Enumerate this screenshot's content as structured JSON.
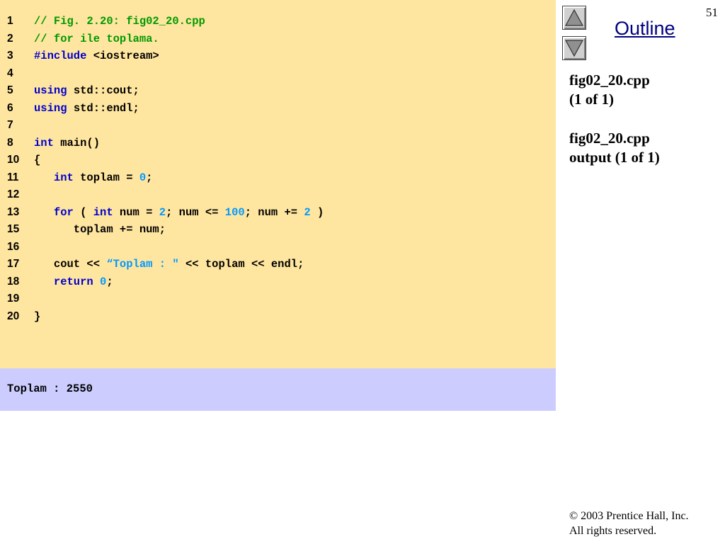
{
  "slide_number": "51",
  "outline": {
    "label": "Outline"
  },
  "nav": {
    "up_icon": "triangle-up-icon",
    "down_icon": "triangle-down-icon"
  },
  "sidebar": {
    "lines": [
      "fig02_20.cpp",
      "(1 of 1)",
      "fig02_20.cpp",
      "output (1 of 1)"
    ]
  },
  "code_lines": [
    {
      "num": "1",
      "tokens": [
        {
          "t": "// Fig. 2.20: fig02_20.cpp",
          "c": "comment"
        }
      ]
    },
    {
      "num": "2",
      "tokens": [
        {
          "t": "// for ile toplama.",
          "c": "comment"
        }
      ]
    },
    {
      "num": "3",
      "tokens": [
        {
          "t": "#include",
          "c": "keyword"
        },
        {
          "t": " <iostream>",
          "c": "plain"
        }
      ]
    },
    {
      "num": "4",
      "tokens": []
    },
    {
      "num": "5",
      "tokens": [
        {
          "t": "using",
          "c": "keyword"
        },
        {
          "t": " std::cout;",
          "c": "plain"
        }
      ]
    },
    {
      "num": "6",
      "tokens": [
        {
          "t": "using",
          "c": "keyword"
        },
        {
          "t": " std::endl;",
          "c": "plain"
        }
      ]
    },
    {
      "num": "7",
      "tokens": []
    },
    {
      "num": "8",
      "tokens": [
        {
          "t": "int",
          "c": "keyword"
        },
        {
          "t": " main()",
          "c": "plain"
        }
      ]
    },
    {
      "num": "10",
      "tokens": [
        {
          "t": "{",
          "c": "plain"
        }
      ]
    },
    {
      "num": "11",
      "tokens": [
        {
          "t": "   ",
          "c": "plain"
        },
        {
          "t": "int",
          "c": "keyword"
        },
        {
          "t": " toplam = ",
          "c": "plain"
        },
        {
          "t": "0",
          "c": "number"
        },
        {
          "t": ";",
          "c": "plain"
        }
      ]
    },
    {
      "num": "12",
      "tokens": []
    },
    {
      "num": "13",
      "tokens": [
        {
          "t": "   ",
          "c": "plain"
        },
        {
          "t": "for",
          "c": "keyword"
        },
        {
          "t": " ( ",
          "c": "plain"
        },
        {
          "t": "int",
          "c": "keyword"
        },
        {
          "t": " num = ",
          "c": "plain"
        },
        {
          "t": "2",
          "c": "number"
        },
        {
          "t": "; num <= ",
          "c": "plain"
        },
        {
          "t": "100",
          "c": "number"
        },
        {
          "t": "; num += ",
          "c": "plain"
        },
        {
          "t": "2",
          "c": "number"
        },
        {
          "t": " )",
          "c": "plain"
        }
      ]
    },
    {
      "num": "15",
      "tokens": [
        {
          "t": "      toplam += num;",
          "c": "plain"
        }
      ]
    },
    {
      "num": "16",
      "tokens": []
    },
    {
      "num": "17",
      "tokens": [
        {
          "t": "   cout << ",
          "c": "plain"
        },
        {
          "t": "“Toplam : \"",
          "c": "string"
        },
        {
          "t": " << toplam << endl;",
          "c": "plain"
        }
      ]
    },
    {
      "num": "18",
      "tokens": [
        {
          "t": "   ",
          "c": "plain"
        },
        {
          "t": "return",
          "c": "keyword"
        },
        {
          "t": " ",
          "c": "plain"
        },
        {
          "t": "0",
          "c": "number"
        },
        {
          "t": ";",
          "c": "plain"
        }
      ]
    },
    {
      "num": "19",
      "tokens": []
    },
    {
      "num": "20",
      "tokens": [
        {
          "t": "}",
          "c": "plain"
        }
      ]
    }
  ],
  "output": {
    "text": "Toplam : 2550"
  },
  "copyright": {
    "line1": "© 2003 Prentice Hall, Inc.",
    "line2": "All rights reserved."
  },
  "colors": {
    "code_bg": "#ffe6a0",
    "output_bg": "#ccccff",
    "comment": "#009900",
    "keyword": "#0000cc",
    "number": "#0099ff",
    "link": "#000080"
  }
}
